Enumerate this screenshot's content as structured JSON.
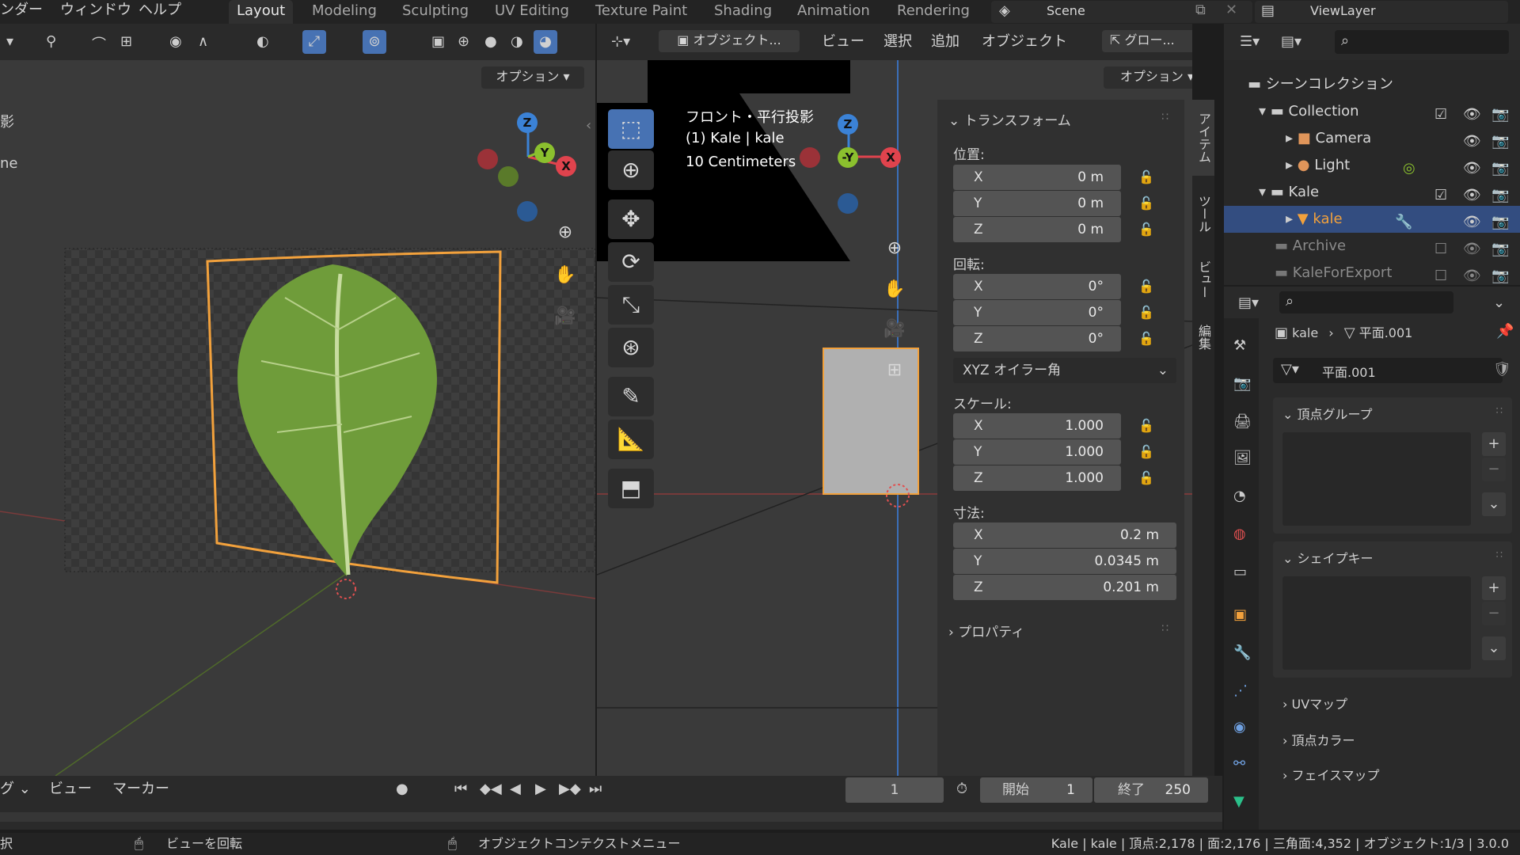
{
  "topmenu": {
    "render_partial": "ンダー",
    "window": "ウィンドウ",
    "help": "ヘルプ"
  },
  "workspaces": [
    "Layout",
    "Modeling",
    "Sculpting",
    "UV Editing",
    "Texture Paint",
    "Shading",
    "Animation",
    "Rendering"
  ],
  "scene": {
    "label": "Scene",
    "view_layer": "ViewLayer"
  },
  "left_viewport": {
    "options_label": "オプション",
    "partial_1": "影",
    "partial_2": "ne",
    "axes": {
      "x": "X",
      "y": "Y",
      "z": "Z"
    }
  },
  "mid_viewport": {
    "header": {
      "mode": "オブジェクト...",
      "view": "ビュー",
      "select": "選択",
      "add": "追加",
      "object": "オブジェクト",
      "transform_orientation": "グロー...",
      "options": "オプション"
    },
    "info": {
      "line1": "フロント・平行投影",
      "line2": "(1) Kale | kale",
      "line3": "10 Centimeters"
    },
    "axes": {
      "x": "X",
      "y": "-Y",
      "z": "Z"
    }
  },
  "sidebar_tabs": [
    "アイテム",
    "ツール",
    "ビュー",
    "編集"
  ],
  "transform": {
    "title": "トランスフォーム",
    "location_label": "位置:",
    "location": [
      {
        "axis": "X",
        "value": "0 m"
      },
      {
        "axis": "Y",
        "value": "0 m"
      },
      {
        "axis": "Z",
        "value": "0 m"
      }
    ],
    "rotation_label": "回転:",
    "rotation": [
      {
        "axis": "X",
        "value": "0°"
      },
      {
        "axis": "Y",
        "value": "0°"
      },
      {
        "axis": "Z",
        "value": "0°"
      }
    ],
    "rotation_mode": "XYZ オイラー角",
    "scale_label": "スケール:",
    "scale": [
      {
        "axis": "X",
        "value": "1.000"
      },
      {
        "axis": "Y",
        "value": "1.000"
      },
      {
        "axis": "Z",
        "value": "1.000"
      }
    ],
    "dimensions_label": "寸法:",
    "dimensions": [
      {
        "axis": "X",
        "value": "0.2 m"
      },
      {
        "axis": "Y",
        "value": "0.0345 m"
      },
      {
        "axis": "Z",
        "value": "0.201 m"
      }
    ],
    "properties_label": "プロパティ"
  },
  "outliner": {
    "items": [
      {
        "label": "シーンコレクション"
      },
      {
        "label": "Collection"
      },
      {
        "label": "Camera"
      },
      {
        "label": "Light"
      },
      {
        "label": "Kale"
      },
      {
        "label": "kale"
      },
      {
        "label": "Archive"
      },
      {
        "label": "KaleForExport"
      }
    ]
  },
  "properties": {
    "breadcrumb_object": "kale",
    "breadcrumb_mesh": "平面.001",
    "mesh_name": "平面.001",
    "panels": {
      "vertex_groups": "頂点グループ",
      "shape_keys": "シェイプキー",
      "uv_maps": "UVマップ",
      "vertex_colors": "頂点カラー",
      "face_maps": "フェイスマップ"
    }
  },
  "timeline": {
    "mode_partial": "グ",
    "view": "ビュー",
    "marker": "マーカー",
    "current_frame": "1",
    "start_label": "開始",
    "start": "1",
    "end_label": "終了",
    "end": "250"
  },
  "statusbar": {
    "select_partial": "択",
    "rotate_view": "ビューを回転",
    "context_menu": "オブジェクトコンテクストメニュー",
    "stats": "Kale | kale | 頂点:2,178 | 面:2,176 | 三角面:4,352 | オブジェクト:1/3 | 3.0.0"
  },
  "colors": {
    "accent": "#4772b3",
    "selected_outline": "#f2a13c",
    "axis_x": "#e0434d",
    "axis_y": "#8bc02e",
    "axis_z": "#3b82d6"
  }
}
